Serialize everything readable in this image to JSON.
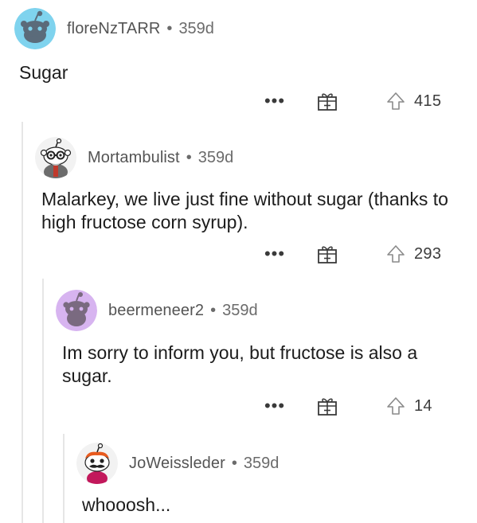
{
  "comments": [
    {
      "username": "floreNzTARR",
      "separator": "•",
      "age": "359d",
      "body": "Sugar",
      "more": "•••",
      "score": "415",
      "avatar": "default-snoo-blue"
    },
    {
      "username": "Mortambulist",
      "separator": "•",
      "age": "359d",
      "body": "Malarkey, we live just fine without sugar (thanks to high fructose corn syrup).",
      "more": "•••",
      "score": "293",
      "avatar": "snoo-glasses-beard"
    },
    {
      "username": "beermeneer2",
      "separator": "•",
      "age": "359d",
      "body": "Im sorry to inform you, but fructose is also a sugar.",
      "more": "•••",
      "score": "14",
      "avatar": "default-snoo-purple"
    },
    {
      "username": "JoWeissleder",
      "separator": "•",
      "age": "359d",
      "body": "whooosh...",
      "avatar": "snoo-mustache-red-hair"
    }
  ],
  "colors": {
    "avatar_blue_bg": "#7fd3ee",
    "avatar_purple_bg": "#d7b4f0",
    "snoo_gray": "#5b6b7a",
    "thread_line": "#e6e6e6"
  },
  "icons": {
    "more": "more-options-icon",
    "gift": "gift-award-icon",
    "upvote": "upvote-arrow-icon"
  }
}
